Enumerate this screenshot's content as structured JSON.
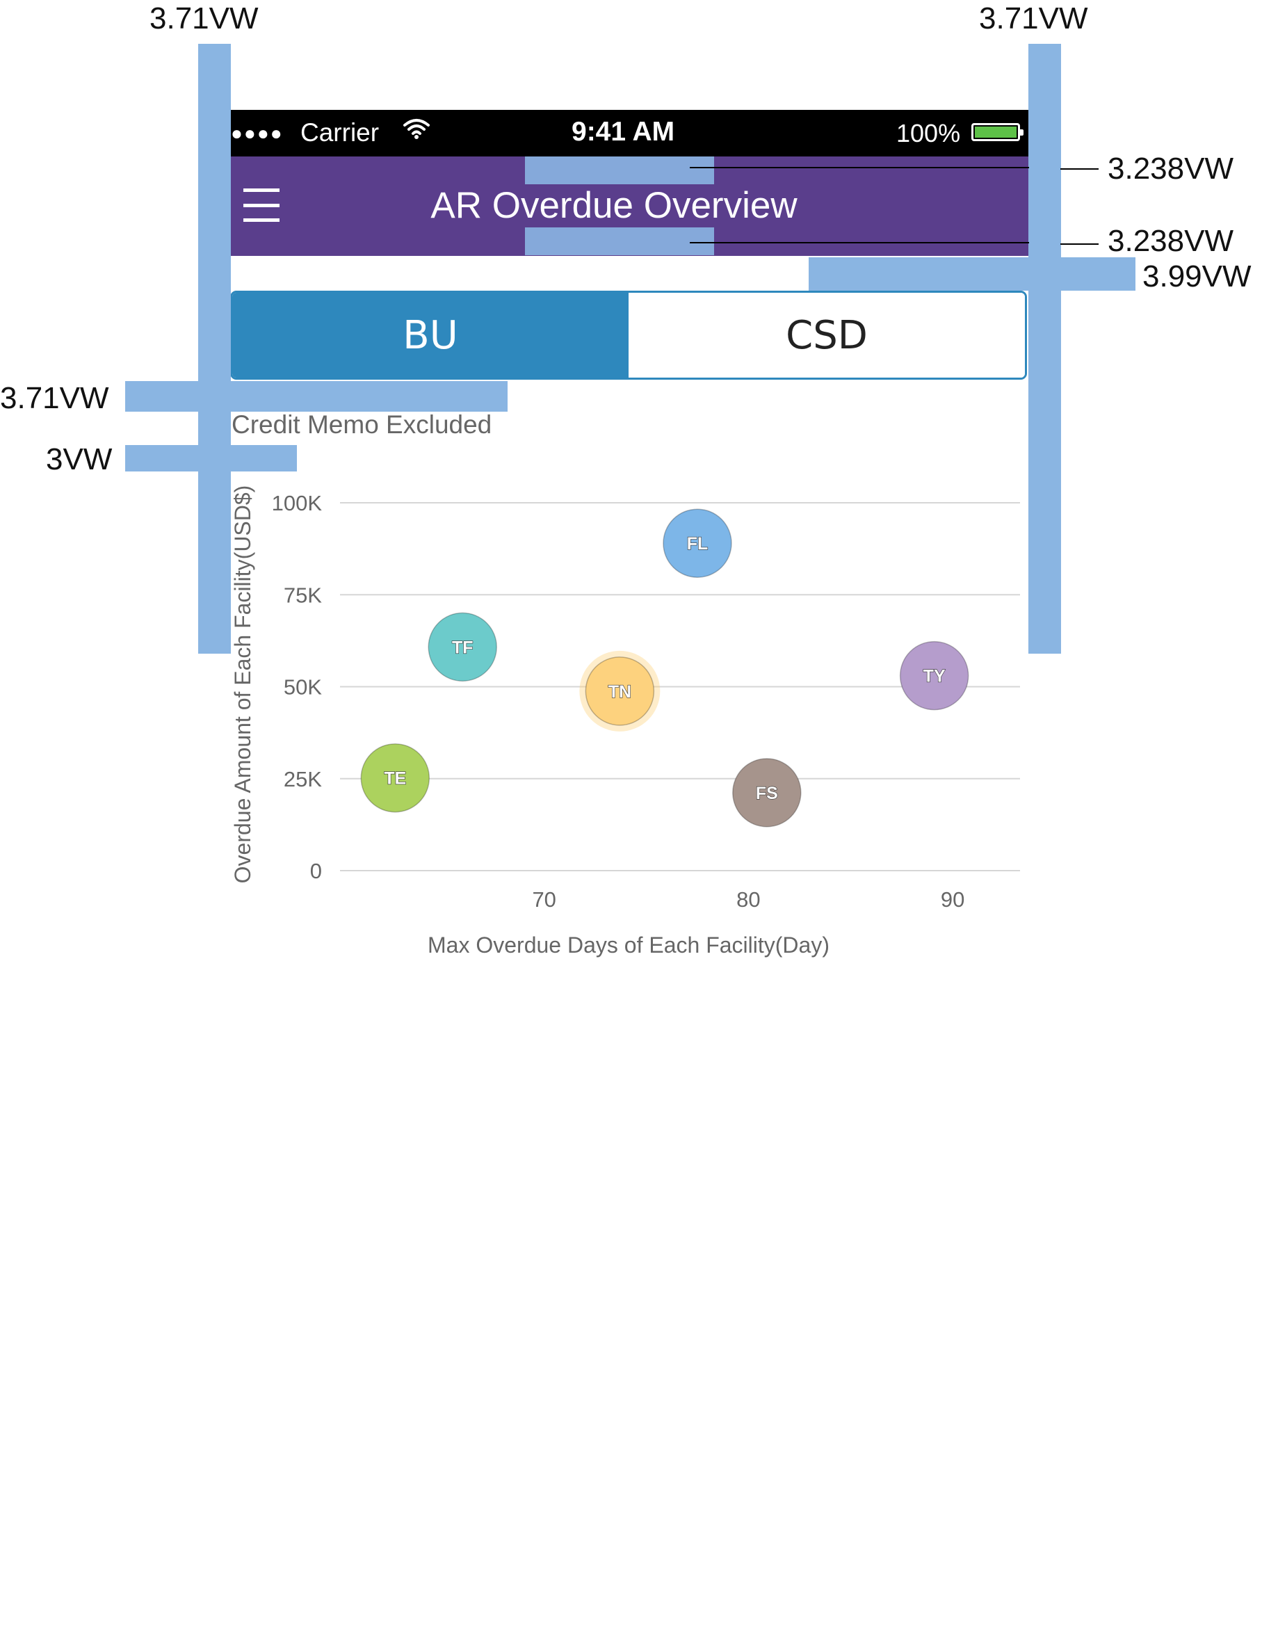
{
  "status_bar": {
    "signal": "●●●●",
    "carrier": "Carrier",
    "time": "9:41 AM",
    "battery_percent": "100%",
    "battery_level": 1.0,
    "battery_color": "#5ec148"
  },
  "header": {
    "menu_icon": "hamburger-menu-icon",
    "title": "AR Overdue Overview",
    "background": "#5a3e8c"
  },
  "tabs": [
    {
      "label": "BU",
      "active": true
    },
    {
      "label": "CSD",
      "active": false
    }
  ],
  "accent_color": "#2e88bd",
  "note": "Credit Memo Excluded",
  "chart_data": {
    "type": "bubble",
    "xlabel": "Max Overdue Days of Each Facility(Day)",
    "ylabel": "Overdue Amount of Each Facility(USD$)",
    "xlim": [
      60,
      93.3
    ],
    "ylim": [
      0,
      100000
    ],
    "x_ticks": [
      {
        "value": 70,
        "label": "70"
      },
      {
        "value": 80,
        "label": "80"
      },
      {
        "value": 90,
        "label": "90"
      }
    ],
    "y_ticks": [
      {
        "value": 0,
        "label": "0"
      },
      {
        "value": 25000,
        "label": "25K"
      },
      {
        "value": 50000,
        "label": "50K"
      },
      {
        "value": 75000,
        "label": "75K"
      },
      {
        "value": 100000,
        "label": "100K"
      }
    ],
    "grid": true,
    "points": [
      {
        "label": "FL",
        "x": 77.5,
        "y": 89000,
        "color": "#7db6e8",
        "highlight": false
      },
      {
        "label": "TF",
        "x": 66.0,
        "y": 60800,
        "color": "#6ccbcb",
        "highlight": false
      },
      {
        "label": "TN",
        "x": 73.7,
        "y": 48800,
        "color": "#fdd27e",
        "highlight": true
      },
      {
        "label": "TY",
        "x": 89.1,
        "y": 53000,
        "color": "#b59dcc",
        "highlight": false
      },
      {
        "label": "TE",
        "x": 62.7,
        "y": 25200,
        "color": "#acd25e",
        "highlight": false
      },
      {
        "label": "FS",
        "x": 80.9,
        "y": 21200,
        "color": "#a6948c",
        "highlight": false
      }
    ]
  },
  "annotations": {
    "top_left": "3.71VW",
    "top_right": "3.71VW",
    "header_top": "3.238VW",
    "header_bottom": "3.238VW",
    "segment_gap": "3.99VW",
    "segment_bottom": "3.71VW",
    "note_gap": "3VW",
    "guide_color": "#8ab5e2"
  }
}
